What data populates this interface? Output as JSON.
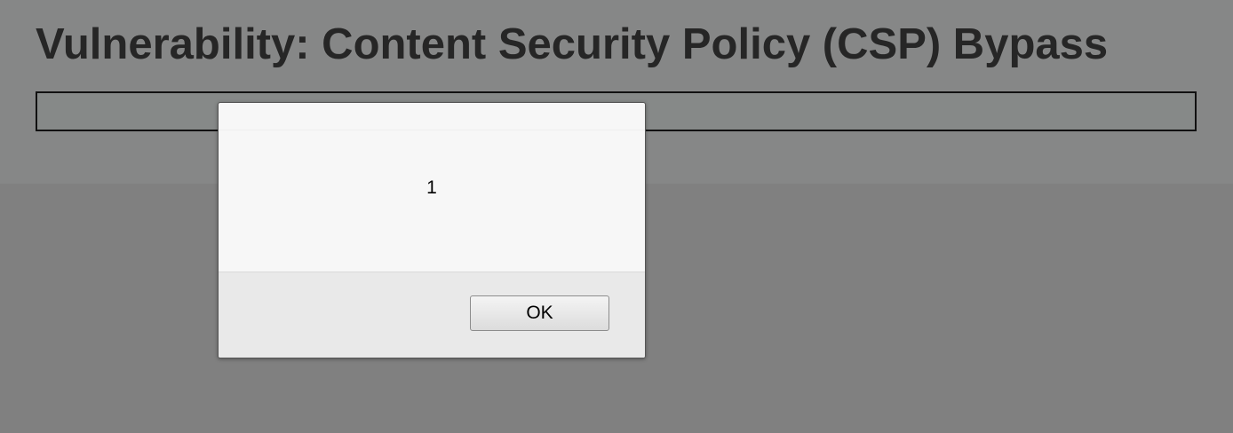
{
  "page": {
    "title": "Vulnerability: Content Security Policy (CSP) Bypass"
  },
  "alert": {
    "message": "1",
    "ok_label": "OK"
  }
}
